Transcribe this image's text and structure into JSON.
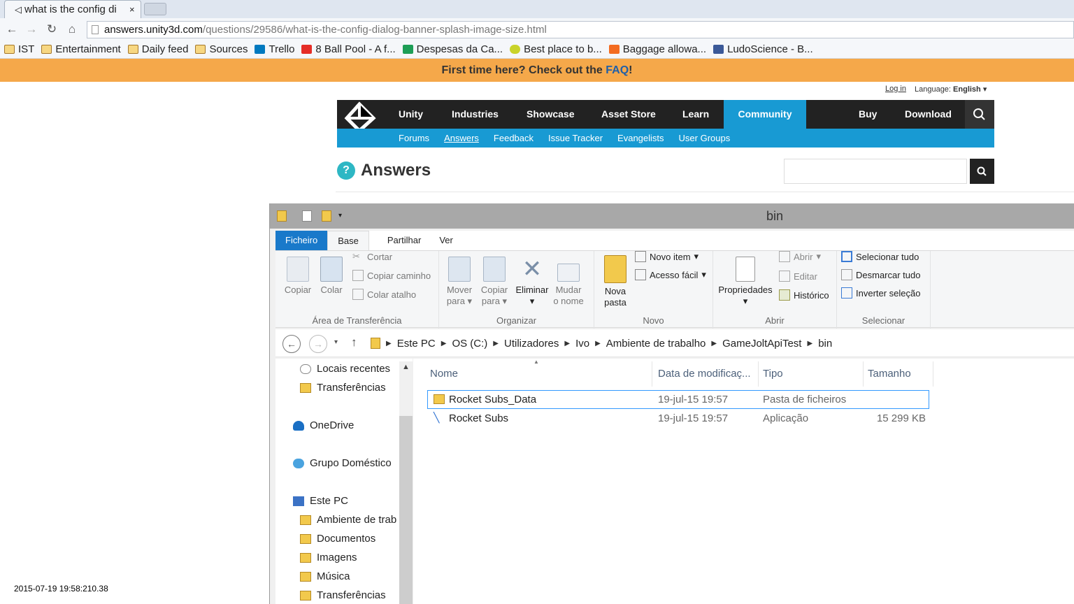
{
  "browser": {
    "tab_title": "what is the config di",
    "tab_close": "×",
    "url_host": "answers.unity3d.com",
    "url_path": "/questions/29586/what-is-the-config-dialog-banner-splash-image-size.html",
    "bookmarks": [
      {
        "label": "IST",
        "icon": "folder-icon"
      },
      {
        "label": "Entertainment",
        "icon": "folder-icon"
      },
      {
        "label": "Daily feed",
        "icon": "folder-icon"
      },
      {
        "label": "Sources",
        "icon": "folder-icon"
      },
      {
        "label": "Trello",
        "icon": "trello-icon"
      },
      {
        "label": "8 Ball Pool - A f...",
        "icon": "play-icon"
      },
      {
        "label": "Despesas da Ca...",
        "icon": "sheet-icon"
      },
      {
        "label": "Best place to b...",
        "icon": "smiley-icon"
      },
      {
        "label": "Baggage allowa...",
        "icon": "e-icon"
      },
      {
        "label": "LudoScience - B...",
        "icon": "facebook-icon"
      }
    ]
  },
  "page": {
    "banner_text": "First time here? Check out the ",
    "banner_link": "FAQ",
    "banner_end": "!",
    "login": "Log in",
    "language_label": "Language:",
    "language_value": "English",
    "nav": [
      "Unity",
      "Industries",
      "Showcase",
      "Asset Store",
      "Learn",
      "Community",
      "Buy",
      "Download"
    ],
    "subnav": [
      "Forums",
      "Answers",
      "Feedback",
      "Issue Tracker",
      "Evangelists",
      "User Groups"
    ],
    "answers_title": "Answers",
    "answers_icon": "?",
    "timestamp": "2015-07-19 19:58:210.38"
  },
  "explorer": {
    "title": "bin",
    "tabs": [
      "Ficheiro",
      "Base",
      "Partilhar",
      "Ver"
    ],
    "clipboard": {
      "copy": "Copiar",
      "paste": "Colar",
      "cut": "Cortar",
      "copy_path": "Copiar caminho",
      "paste_shortcut": "Colar atalho",
      "group": "Área de Transferência"
    },
    "organize": {
      "move1": "Mover",
      "move2": "para",
      "copy1": "Copiar",
      "copy2": "para",
      "delete": "Eliminar",
      "rename1": "Mudar",
      "rename2": "o nome",
      "group": "Organizar"
    },
    "new": {
      "folder1": "Nova",
      "folder2": "pasta",
      "new_item": "Novo item",
      "easy_access": "Acesso fácil",
      "group": "Novo"
    },
    "open": {
      "properties": "Propriedades",
      "open": "Abrir",
      "edit": "Editar",
      "history": "Histórico",
      "group": "Abrir"
    },
    "select": {
      "all": "Selecionar tudo",
      "none": "Desmarcar tudo",
      "invert": "Inverter seleção",
      "group": "Selecionar"
    },
    "breadcrumb": [
      "Este PC",
      "OS (C:)",
      "Utilizadores",
      "Ivo",
      "Ambiente de trabalho",
      "GameJoltApiTest",
      "bin"
    ],
    "nav_pane": [
      {
        "label": "Locais recentes",
        "icon": "recent-icon"
      },
      {
        "label": "Transferências",
        "icon": "downloads-icon"
      },
      {
        "label": "OneDrive",
        "icon": "onedrive-icon"
      },
      {
        "label": "Grupo Doméstico",
        "icon": "homegroup-icon"
      },
      {
        "label": "Este PC",
        "icon": "pc-icon"
      },
      {
        "label": "Ambiente de trab",
        "icon": "desktop-icon"
      },
      {
        "label": "Documentos",
        "icon": "documents-icon"
      },
      {
        "label": "Imagens",
        "icon": "pictures-icon"
      },
      {
        "label": "Música",
        "icon": "music-icon"
      },
      {
        "label": "Transferências",
        "icon": "downloads-icon"
      }
    ],
    "columns": [
      "Nome",
      "Data de modificaç...",
      "Tipo",
      "Tamanho"
    ],
    "files": [
      {
        "name": "Rocket Subs_Data",
        "date": "19-jul-15 19:57",
        "type": "Pasta de ficheiros",
        "size": ""
      },
      {
        "name": "Rocket Subs",
        "date": "19-jul-15 19:57",
        "type": "Aplicação",
        "size": "15 299 KB"
      }
    ]
  },
  "colors": {
    "banner": "#f5a84a",
    "unity_dark": "#222222",
    "unity_blue": "#189ad3",
    "file_tab": "#1979ca"
  }
}
